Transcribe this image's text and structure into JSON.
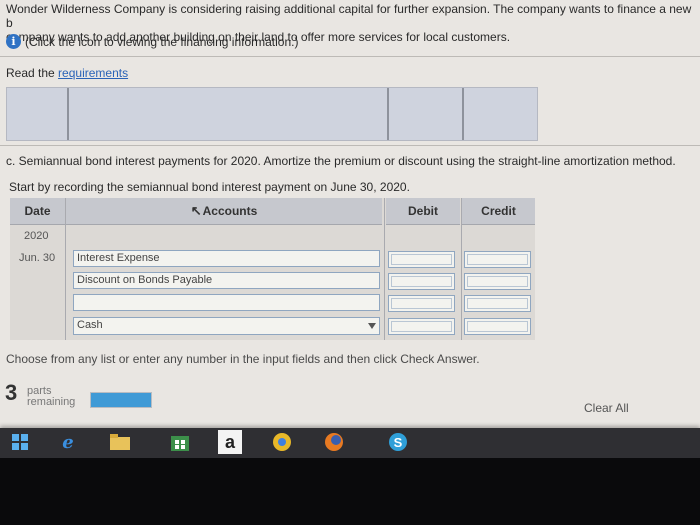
{
  "intro": {
    "line1": "Wonder Wilderness Company is considering raising additional capital for further expansion. The company wants to finance a new b",
    "line2": "company wants to add another building on their land to offer more services for local customers.",
    "info_text": "(Click the icon to viewing the financing information.)"
  },
  "requirements": {
    "prefix": "Read the ",
    "link": "requirements"
  },
  "question": {
    "part": "c. Semiannual bond interest payments for 2020. Amortize the premium or discount using the straight-line amortization method.",
    "sub": "Start by recording the semiannual bond interest payment on June 30, 2020."
  },
  "journal": {
    "headers": {
      "date": "Date",
      "accounts": "Accounts",
      "debit": "Debit",
      "credit": "Credit"
    },
    "year": "2020",
    "date": "Jun. 30",
    "rows": [
      {
        "account": "Interest Expense"
      },
      {
        "account": "Discount on Bonds Payable"
      },
      {
        "account": ""
      },
      {
        "account": "Cash"
      }
    ]
  },
  "instruction": "Choose from any list or enter any number in the input fields and then click Check Answer.",
  "status": {
    "parts_count": "3",
    "parts_label_1": "parts",
    "parts_label_2": "remaining",
    "progress": 1.0
  },
  "clear_all": "Clear All",
  "taskbar": {
    "items": [
      "windows-icon",
      "edge-icon",
      "file-explorer-icon",
      "store-icon",
      "amazon-icon",
      "chrome-icon",
      "firefox-icon",
      "skype-icon"
    ],
    "amazon_glyph": "a"
  },
  "colors": {
    "accent": "#2f72c4",
    "link": "#2a63b8",
    "progress": "#3f9ad6",
    "taskbar": "#2f2f33"
  }
}
